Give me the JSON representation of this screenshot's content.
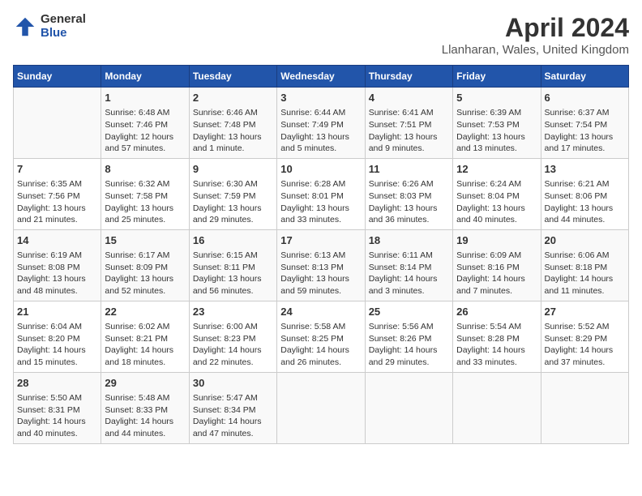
{
  "header": {
    "logo_general": "General",
    "logo_blue": "Blue",
    "title": "April 2024",
    "subtitle": "Llanharan, Wales, United Kingdom"
  },
  "days_of_week": [
    "Sunday",
    "Monday",
    "Tuesday",
    "Wednesday",
    "Thursday",
    "Friday",
    "Saturday"
  ],
  "weeks": [
    [
      {
        "day": "",
        "content": ""
      },
      {
        "day": "1",
        "content": "Sunrise: 6:48 AM\nSunset: 7:46 PM\nDaylight: 12 hours\nand 57 minutes."
      },
      {
        "day": "2",
        "content": "Sunrise: 6:46 AM\nSunset: 7:48 PM\nDaylight: 13 hours\nand 1 minute."
      },
      {
        "day": "3",
        "content": "Sunrise: 6:44 AM\nSunset: 7:49 PM\nDaylight: 13 hours\nand 5 minutes."
      },
      {
        "day": "4",
        "content": "Sunrise: 6:41 AM\nSunset: 7:51 PM\nDaylight: 13 hours\nand 9 minutes."
      },
      {
        "day": "5",
        "content": "Sunrise: 6:39 AM\nSunset: 7:53 PM\nDaylight: 13 hours\nand 13 minutes."
      },
      {
        "day": "6",
        "content": "Sunrise: 6:37 AM\nSunset: 7:54 PM\nDaylight: 13 hours\nand 17 minutes."
      }
    ],
    [
      {
        "day": "7",
        "content": "Sunrise: 6:35 AM\nSunset: 7:56 PM\nDaylight: 13 hours\nand 21 minutes."
      },
      {
        "day": "8",
        "content": "Sunrise: 6:32 AM\nSunset: 7:58 PM\nDaylight: 13 hours\nand 25 minutes."
      },
      {
        "day": "9",
        "content": "Sunrise: 6:30 AM\nSunset: 7:59 PM\nDaylight: 13 hours\nand 29 minutes."
      },
      {
        "day": "10",
        "content": "Sunrise: 6:28 AM\nSunset: 8:01 PM\nDaylight: 13 hours\nand 33 minutes."
      },
      {
        "day": "11",
        "content": "Sunrise: 6:26 AM\nSunset: 8:03 PM\nDaylight: 13 hours\nand 36 minutes."
      },
      {
        "day": "12",
        "content": "Sunrise: 6:24 AM\nSunset: 8:04 PM\nDaylight: 13 hours\nand 40 minutes."
      },
      {
        "day": "13",
        "content": "Sunrise: 6:21 AM\nSunset: 8:06 PM\nDaylight: 13 hours\nand 44 minutes."
      }
    ],
    [
      {
        "day": "14",
        "content": "Sunrise: 6:19 AM\nSunset: 8:08 PM\nDaylight: 13 hours\nand 48 minutes."
      },
      {
        "day": "15",
        "content": "Sunrise: 6:17 AM\nSunset: 8:09 PM\nDaylight: 13 hours\nand 52 minutes."
      },
      {
        "day": "16",
        "content": "Sunrise: 6:15 AM\nSunset: 8:11 PM\nDaylight: 13 hours\nand 56 minutes."
      },
      {
        "day": "17",
        "content": "Sunrise: 6:13 AM\nSunset: 8:13 PM\nDaylight: 13 hours\nand 59 minutes."
      },
      {
        "day": "18",
        "content": "Sunrise: 6:11 AM\nSunset: 8:14 PM\nDaylight: 14 hours\nand 3 minutes."
      },
      {
        "day": "19",
        "content": "Sunrise: 6:09 AM\nSunset: 8:16 PM\nDaylight: 14 hours\nand 7 minutes."
      },
      {
        "day": "20",
        "content": "Sunrise: 6:06 AM\nSunset: 8:18 PM\nDaylight: 14 hours\nand 11 minutes."
      }
    ],
    [
      {
        "day": "21",
        "content": "Sunrise: 6:04 AM\nSunset: 8:20 PM\nDaylight: 14 hours\nand 15 minutes."
      },
      {
        "day": "22",
        "content": "Sunrise: 6:02 AM\nSunset: 8:21 PM\nDaylight: 14 hours\nand 18 minutes."
      },
      {
        "day": "23",
        "content": "Sunrise: 6:00 AM\nSunset: 8:23 PM\nDaylight: 14 hours\nand 22 minutes."
      },
      {
        "day": "24",
        "content": "Sunrise: 5:58 AM\nSunset: 8:25 PM\nDaylight: 14 hours\nand 26 minutes."
      },
      {
        "day": "25",
        "content": "Sunrise: 5:56 AM\nSunset: 8:26 PM\nDaylight: 14 hours\nand 29 minutes."
      },
      {
        "day": "26",
        "content": "Sunrise: 5:54 AM\nSunset: 8:28 PM\nDaylight: 14 hours\nand 33 minutes."
      },
      {
        "day": "27",
        "content": "Sunrise: 5:52 AM\nSunset: 8:29 PM\nDaylight: 14 hours\nand 37 minutes."
      }
    ],
    [
      {
        "day": "28",
        "content": "Sunrise: 5:50 AM\nSunset: 8:31 PM\nDaylight: 14 hours\nand 40 minutes."
      },
      {
        "day": "29",
        "content": "Sunrise: 5:48 AM\nSunset: 8:33 PM\nDaylight: 14 hours\nand 44 minutes."
      },
      {
        "day": "30",
        "content": "Sunrise: 5:47 AM\nSunset: 8:34 PM\nDaylight: 14 hours\nand 47 minutes."
      },
      {
        "day": "",
        "content": ""
      },
      {
        "day": "",
        "content": ""
      },
      {
        "day": "",
        "content": ""
      },
      {
        "day": "",
        "content": ""
      }
    ]
  ]
}
